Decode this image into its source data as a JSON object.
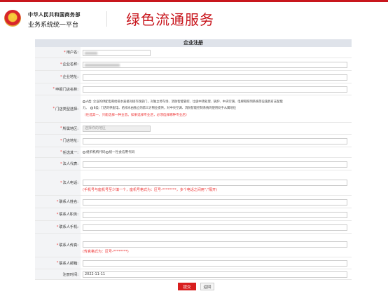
{
  "header": {
    "org_line1": "中华人民共和国商务部",
    "org_line2": "业务系统统一平台",
    "service_title": "绿色流通服务"
  },
  "form": {
    "title": "企业注册",
    "labels": {
      "username": "用户名:",
      "company_name": "企业名称:",
      "company_address": "企业地址:",
      "store_name": "申报门店名称:",
      "store_type": "门店类型选择:",
      "region": "所属地区:",
      "store_address": "门店地址:",
      "choose_one": "任选其一:",
      "legal_rep": "法人代表:",
      "legal_phone": "法人电话:",
      "contact_name": "联系人姓名:",
      "contact_title": "联系人职务:",
      "contact_mobile": "联系人手机:",
      "contact_fax": "联系人传真:",
      "contact_email": "联系人邮箱:",
      "reg_time": "注册时间:"
    },
    "store_type": {
      "option_a": "A类: 企业的供配电和给排水直接对接市政部门，对独立停车场、消防智能管控、垃圾中转处理、锅炉、中央空调、电梯和照明系统等设施具有支配能",
      "option_a_cont": "力。",
      "option_b": "B类: 门店的供配电、给排水由独立的第三方物业提供，对中央空调、消防智能控制系统的使用处于从属地位",
      "note": "（任选其一，只能选择一种业态。如果选择专业店，必须选择哪种专业店）"
    },
    "region_placeholder": "选择你的地区",
    "code_options": {
      "org_code": "组织机构代码",
      "credit_code": "统一社会信用代码"
    },
    "phone_hint": "(手机号与座机号至少填一个，座机号格式为：区号-********，多个电话之间用\";\"隔开)",
    "fax_hint": "(传真格式为：区号-********)",
    "reg_time_value": "2022-11-11"
  },
  "buttons": {
    "submit": "提交",
    "back": "返回"
  },
  "colors": {
    "brand_red": "#c8161d",
    "label_bg": "#f3f4f6",
    "title_bar_bg": "#dfe3ea"
  }
}
